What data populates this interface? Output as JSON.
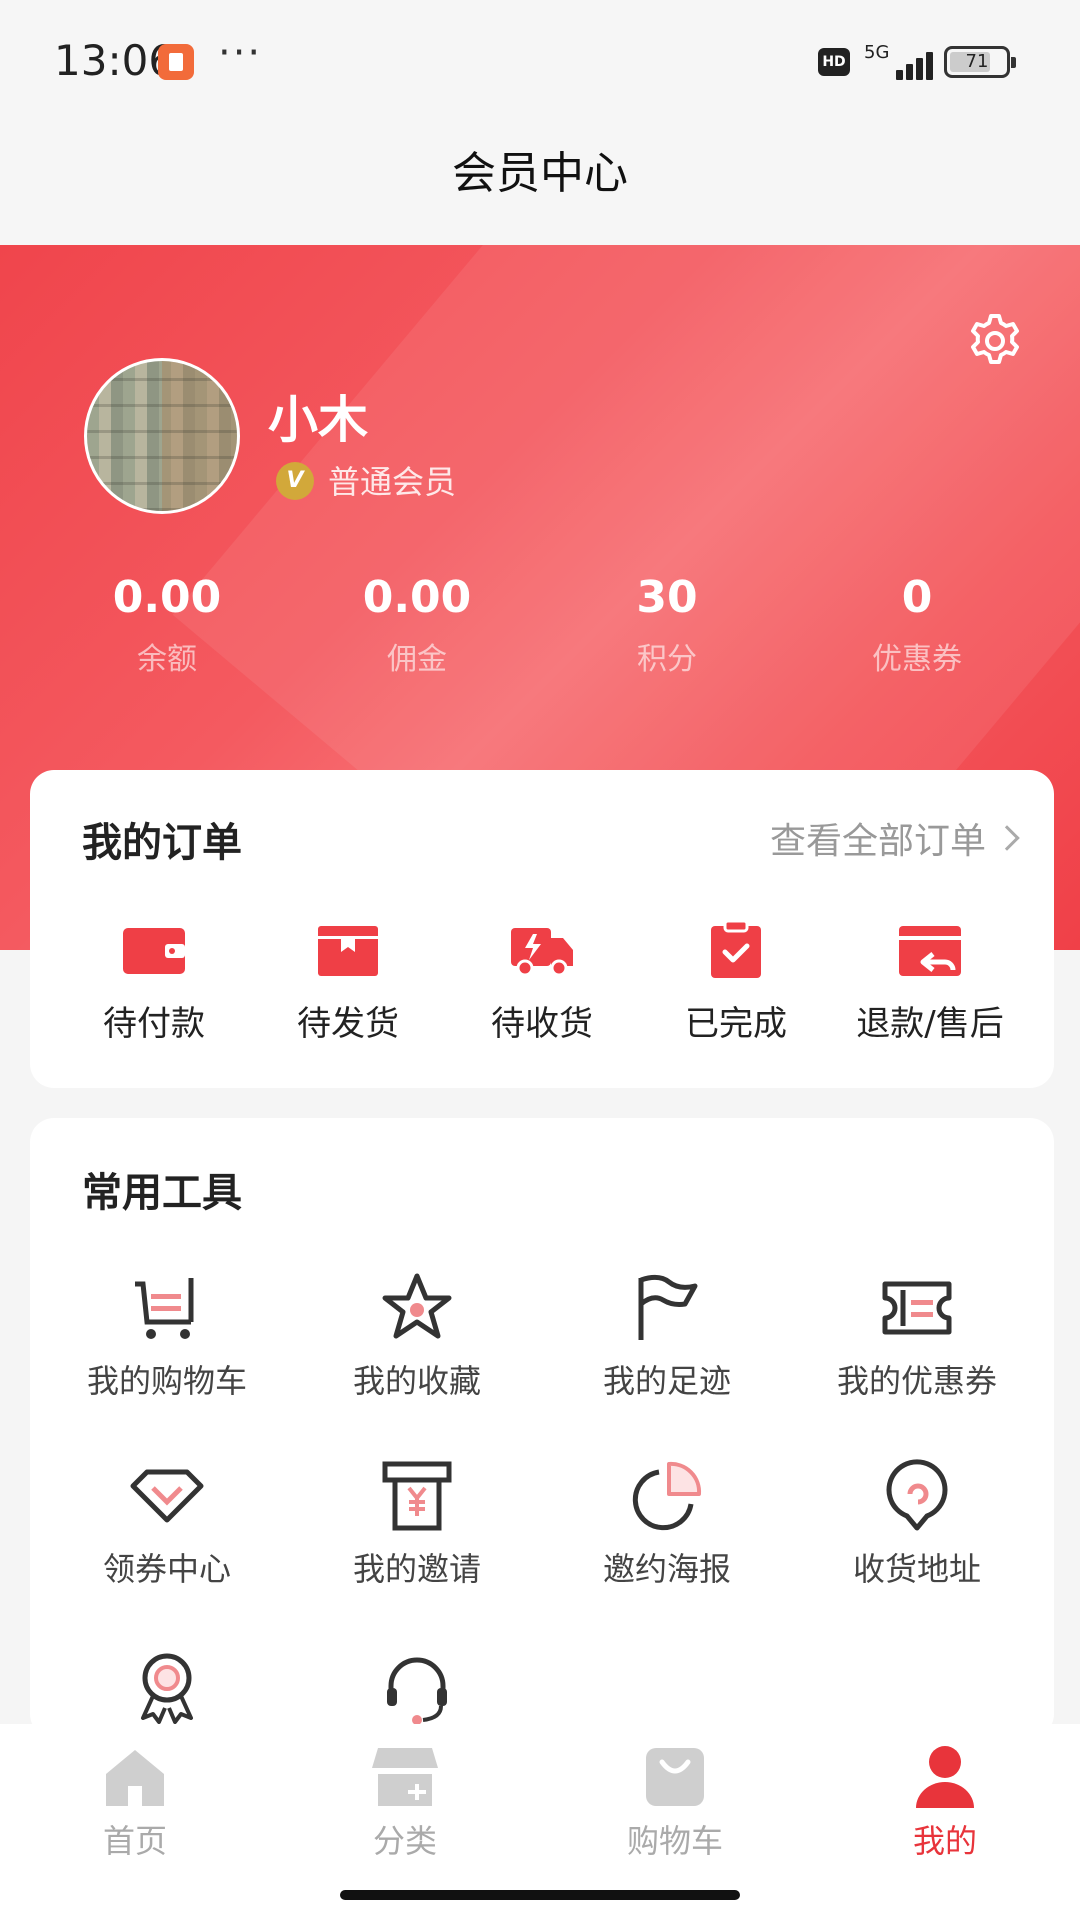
{
  "status_bar": {
    "time": "13:06",
    "dots": "···",
    "hd": "HD",
    "network": "5G",
    "battery": "71"
  },
  "page_title": "会员中心",
  "profile": {
    "name": "小木",
    "badge": "V",
    "member_level": "普通会员"
  },
  "stats": [
    {
      "value": "0.00",
      "label": "余额"
    },
    {
      "value": "0.00",
      "label": "佣金"
    },
    {
      "value": "30",
      "label": "积分"
    },
    {
      "value": "0",
      "label": "优惠券"
    }
  ],
  "orders": {
    "title": "我的订单",
    "view_all": "查看全部订单",
    "items": [
      {
        "label": "待付款",
        "icon": "wallet-icon"
      },
      {
        "label": "待发货",
        "icon": "package-icon"
      },
      {
        "label": "待收货",
        "icon": "delivery-truck-icon"
      },
      {
        "label": "已完成",
        "icon": "clipboard-check-icon"
      },
      {
        "label": "退款/售后",
        "icon": "refund-icon"
      }
    ]
  },
  "tools": {
    "title": "常用工具",
    "items": [
      {
        "label": "我的购物车",
        "icon": "cart-icon"
      },
      {
        "label": "我的收藏",
        "icon": "star-icon"
      },
      {
        "label": "我的足迹",
        "icon": "flag-icon"
      },
      {
        "label": "我的优惠券",
        "icon": "coupon-ticket-icon"
      },
      {
        "label": "领券中心",
        "icon": "diamond-icon"
      },
      {
        "label": "我的邀请",
        "icon": "yen-invite-icon"
      },
      {
        "label": "邀约海报",
        "icon": "pie-chart-icon"
      },
      {
        "label": "收货地址",
        "icon": "location-pin-icon"
      },
      {
        "label": "",
        "icon": "award-medal-icon"
      },
      {
        "label": "",
        "icon": "headset-icon"
      }
    ]
  },
  "tabs": [
    {
      "label": "首页",
      "icon": "home-icon",
      "active": false
    },
    {
      "label": "分类",
      "icon": "store-icon",
      "active": false
    },
    {
      "label": "购物车",
      "icon": "shopping-bag-icon",
      "active": false
    },
    {
      "label": "我的",
      "icon": "user-icon",
      "active": true
    }
  ],
  "colors": {
    "brand_red": "#f0454c",
    "active_tab": "#e8343b",
    "icon_accent": "#f08a8d",
    "icon_dark": "#333333"
  }
}
